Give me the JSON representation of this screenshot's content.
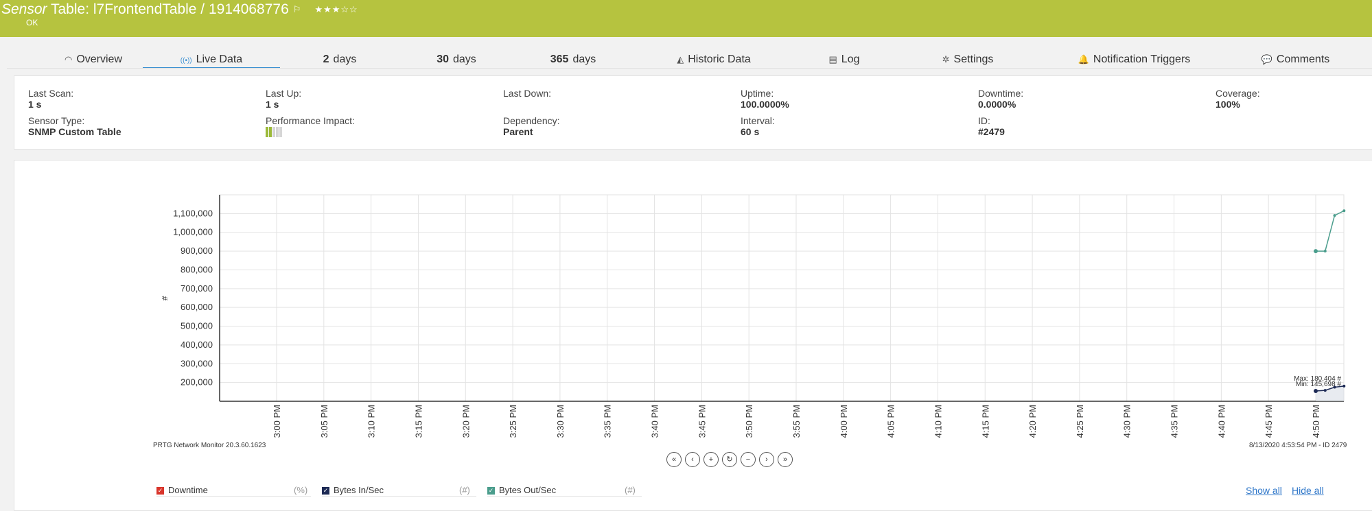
{
  "header": {
    "title_prefix": "Sensor",
    "title_rest": " Table: l7FrontendTable / 1914068776",
    "flag_icon": "flag-icon",
    "stars": "★★★☆☆",
    "status": "OK",
    "color": "#b6c33f"
  },
  "tabs": [
    {
      "label": "Overview",
      "icon": "gauge-icon",
      "glyph": "◠"
    },
    {
      "label": "Live Data",
      "icon": "broadcast-icon",
      "glyph": "((•))"
    },
    {
      "num": "2",
      "label": "days"
    },
    {
      "num": "30",
      "label": "days"
    },
    {
      "num": "365",
      "label": "days"
    },
    {
      "label": "Historic Data",
      "icon": "area-chart-icon",
      "glyph": "◭"
    },
    {
      "label": "Log",
      "icon": "list-icon",
      "glyph": "▤"
    },
    {
      "label": "Settings",
      "icon": "gear-icon",
      "glyph": "✲"
    },
    {
      "label": "Notification Triggers",
      "icon": "bell-icon",
      "glyph": "🔔"
    },
    {
      "label": "Comments",
      "icon": "comment-icon",
      "glyph": "💬"
    }
  ],
  "info": {
    "last_scan": {
      "label": "Last Scan:",
      "value": "1 s"
    },
    "last_up": {
      "label": "Last Up:",
      "value": "1 s"
    },
    "last_down": {
      "label": "Last Down:",
      "value": ""
    },
    "uptime": {
      "label": "Uptime:",
      "value": "100.0000%"
    },
    "downtime": {
      "label": "Downtime:",
      "value": "0.0000%"
    },
    "coverage": {
      "label": "Coverage:",
      "value": "100%"
    },
    "sensor_type": {
      "label": "Sensor Type:",
      "value": "SNMP Custom Table"
    },
    "performance_impact": {
      "label": "Performance Impact:",
      "level": 2,
      "of": 5
    },
    "dependency": {
      "label": "Dependency:",
      "value": "Parent"
    },
    "interval": {
      "label": "Interval:",
      "value": "60 s"
    },
    "id": {
      "label": "ID:",
      "value": "#2479"
    }
  },
  "chart_data": {
    "type": "line",
    "ylabel": "#",
    "y_ticks": [
      "200,000",
      "300,000",
      "400,000",
      "500,000",
      "600,000",
      "700,000",
      "800,000",
      "900,000",
      "1,000,000",
      "1,100,000"
    ],
    "ylim": [
      100000,
      1200000
    ],
    "x_ticks": [
      "3:00 PM",
      "3:05 PM",
      "3:10 PM",
      "3:15 PM",
      "3:20 PM",
      "3:25 PM",
      "3:30 PM",
      "3:35 PM",
      "3:40 PM",
      "3:45 PM",
      "3:50 PM",
      "3:55 PM",
      "4:00 PM",
      "4:05 PM",
      "4:10 PM",
      "4:15 PM",
      "4:20 PM",
      "4:25 PM",
      "4:30 PM",
      "4:35 PM",
      "4:40 PM",
      "4:45 PM",
      "4:50 PM"
    ],
    "grid": true,
    "series": [
      {
        "name": "Bytes Out/Sec",
        "color": "#4a9d8c",
        "x": [
          "4:50 PM",
          "4:51 PM",
          "4:52 PM",
          "4:53 PM"
        ],
        "values": [
          900000,
          900000,
          1090000,
          1115000
        ]
      },
      {
        "name": "Bytes In/Sec",
        "color": "#1d2a55",
        "x": [
          "4:50 PM",
          "4:51 PM",
          "4:52 PM",
          "4:53 PM"
        ],
        "values": [
          155000,
          158000,
          175000,
          181000
        ]
      }
    ],
    "annotations": [
      "Max: 180,404 #",
      "Min: 145,698 #"
    ]
  },
  "footer": {
    "left": "PRTG Network Monitor 20.3.60.1623",
    "right": "8/13/2020 4:53:54 PM - ID 2479"
  },
  "nav_buttons": [
    {
      "glyph": "«",
      "icon": "first-icon"
    },
    {
      "glyph": "‹",
      "icon": "prev-icon"
    },
    {
      "glyph": "+",
      "icon": "zoom-in-icon"
    },
    {
      "glyph": "↻",
      "icon": "reset-icon"
    },
    {
      "glyph": "−",
      "icon": "zoom-out-icon"
    },
    {
      "glyph": "›",
      "icon": "next-icon"
    },
    {
      "glyph": "»",
      "icon": "last-icon"
    }
  ],
  "legend": [
    {
      "label": "Downtime",
      "unit": "(%)",
      "color": "#d9352b"
    },
    {
      "label": "Bytes In/Sec",
      "unit": "(#)",
      "color": "#1d2a55"
    },
    {
      "label": "Bytes Out/Sec",
      "unit": "(#)",
      "color": "#4a9d8c"
    }
  ],
  "legend_links": {
    "show_all": "Show all",
    "hide_all": "Hide all"
  }
}
